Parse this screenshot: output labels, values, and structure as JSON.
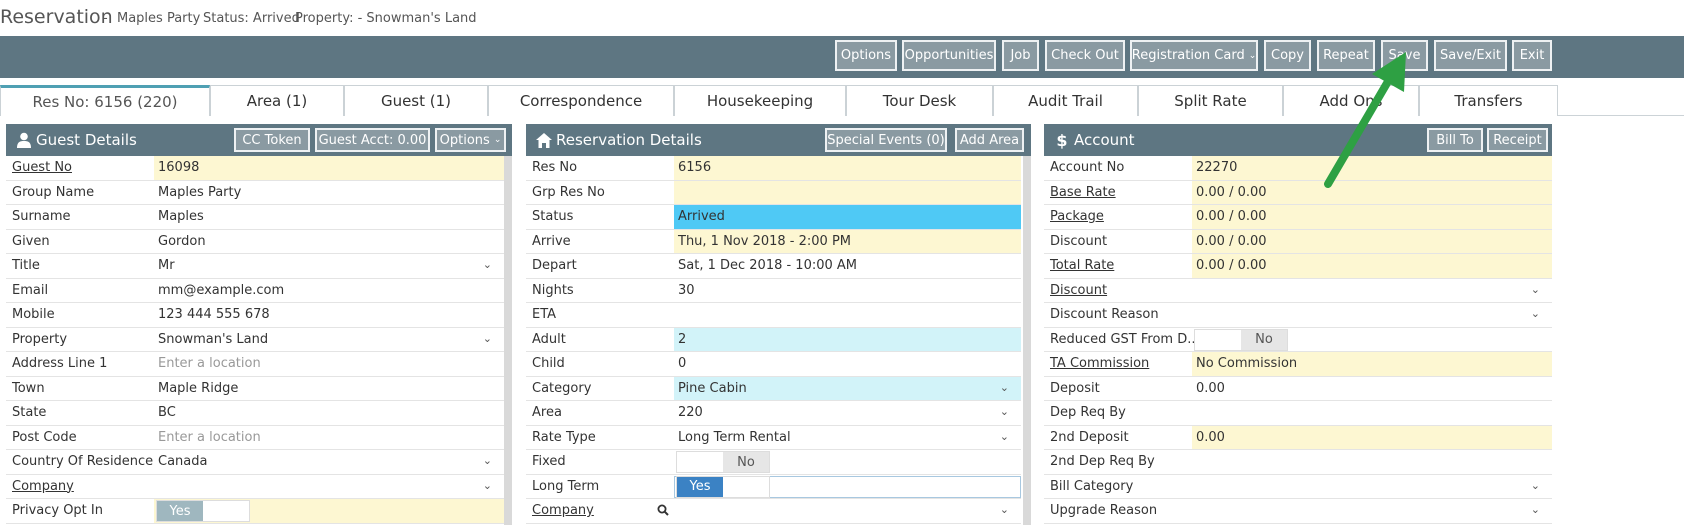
{
  "header": {
    "title": "Reservation",
    "separator": "-",
    "group": "Maples Party",
    "status": "Status: Arrived",
    "property": "Property: - Snowman's Land"
  },
  "toolbar": {
    "buttons": [
      "Options",
      "Opportunities",
      "Job",
      "Check Out",
      "Registration Card",
      "Copy",
      "Repeat",
      "Save",
      "Save/Exit",
      "Exit"
    ]
  },
  "tabs": [
    "Res No: 6156 (220)",
    "Area (1)",
    "Guest (1)",
    "Correspondence",
    "Housekeeping",
    "Tour Desk",
    "Audit Trail",
    "Split Rate",
    "Add Ons",
    "Transfers"
  ],
  "guest": {
    "title": "Guest Details",
    "buttons": [
      "CC Token",
      "Guest Acct: 0.00",
      "Options"
    ],
    "rows": [
      {
        "label": "Guest No",
        "value": "16098"
      },
      {
        "label": "Group Name",
        "value": "Maples Party"
      },
      {
        "label": "Surname",
        "value": "Maples"
      },
      {
        "label": "Given",
        "value": "Gordon"
      },
      {
        "label": "Title",
        "value": "Mr"
      },
      {
        "label": "Email",
        "value": "mm@example.com"
      },
      {
        "label": "Mobile",
        "value": "123 444 555 678"
      },
      {
        "label": "Property",
        "value": "Snowman's Land"
      },
      {
        "label": "Address Line 1",
        "value": "Enter a location"
      },
      {
        "label": "Town",
        "value": "Maple Ridge"
      },
      {
        "label": "State",
        "value": "BC"
      },
      {
        "label": "Post Code",
        "value": "Enter a location"
      },
      {
        "label": "Country Of Residence",
        "value": "Canada"
      },
      {
        "label": "Company",
        "value": ""
      },
      {
        "label": "Privacy Opt In",
        "value": "Yes"
      }
    ]
  },
  "reservation": {
    "title": "Reservation Details",
    "buttons": [
      "Special Events (0)",
      "Add Area"
    ],
    "rows": [
      {
        "label": "Res No",
        "value": "6156"
      },
      {
        "label": "Grp Res No",
        "value": ""
      },
      {
        "label": "Status",
        "value": "Arrived"
      },
      {
        "label": "Arrive",
        "value": "Thu, 1 Nov 2018 - 2:00 PM"
      },
      {
        "label": "Depart",
        "value": "Sat, 1 Dec 2018 - 10:00 AM"
      },
      {
        "label": "Nights",
        "value": "30"
      },
      {
        "label": "ETA",
        "value": ""
      },
      {
        "label": "Adult",
        "value": "2"
      },
      {
        "label": "Child",
        "value": "0"
      },
      {
        "label": "Category",
        "value": "Pine Cabin"
      },
      {
        "label": "Area",
        "value": "220"
      },
      {
        "label": "Rate Type",
        "value": "Long Term Rental"
      },
      {
        "label": "Fixed",
        "value": "No"
      },
      {
        "label": "Long Term",
        "value": "Yes"
      },
      {
        "label": "Company",
        "value": ""
      }
    ]
  },
  "account": {
    "title": "Account",
    "buttons": [
      "Bill To",
      "Receipt"
    ],
    "rows": [
      {
        "label": "Account No",
        "value": "22270"
      },
      {
        "label": "Base Rate",
        "value": "0.00 / 0.00"
      },
      {
        "label": "Package",
        "value": "0.00 / 0.00"
      },
      {
        "label": "Discount",
        "value": "0.00 / 0.00"
      },
      {
        "label": "Total Rate",
        "value": "0.00 / 0.00"
      },
      {
        "label": "Discount",
        "value": ""
      },
      {
        "label": "Discount Reason",
        "value": ""
      },
      {
        "label": "Reduced GST From D...",
        "value": "No"
      },
      {
        "label": "TA Commission",
        "value": "No Commission"
      },
      {
        "label": "Deposit",
        "value": "0.00"
      },
      {
        "label": "Dep Req By",
        "value": ""
      },
      {
        "label": "2nd Deposit",
        "value": "0.00"
      },
      {
        "label": "2nd Dep Req By",
        "value": ""
      },
      {
        "label": "Bill Category",
        "value": ""
      },
      {
        "label": "Upgrade Reason",
        "value": ""
      }
    ]
  },
  "colors": {
    "bar": "#5e7682",
    "button": "#8a9aa2",
    "highlight_yellow": "#fdf7d2",
    "status_blue": "#4fc9f5",
    "annotation_arrow": "#2ea043"
  }
}
